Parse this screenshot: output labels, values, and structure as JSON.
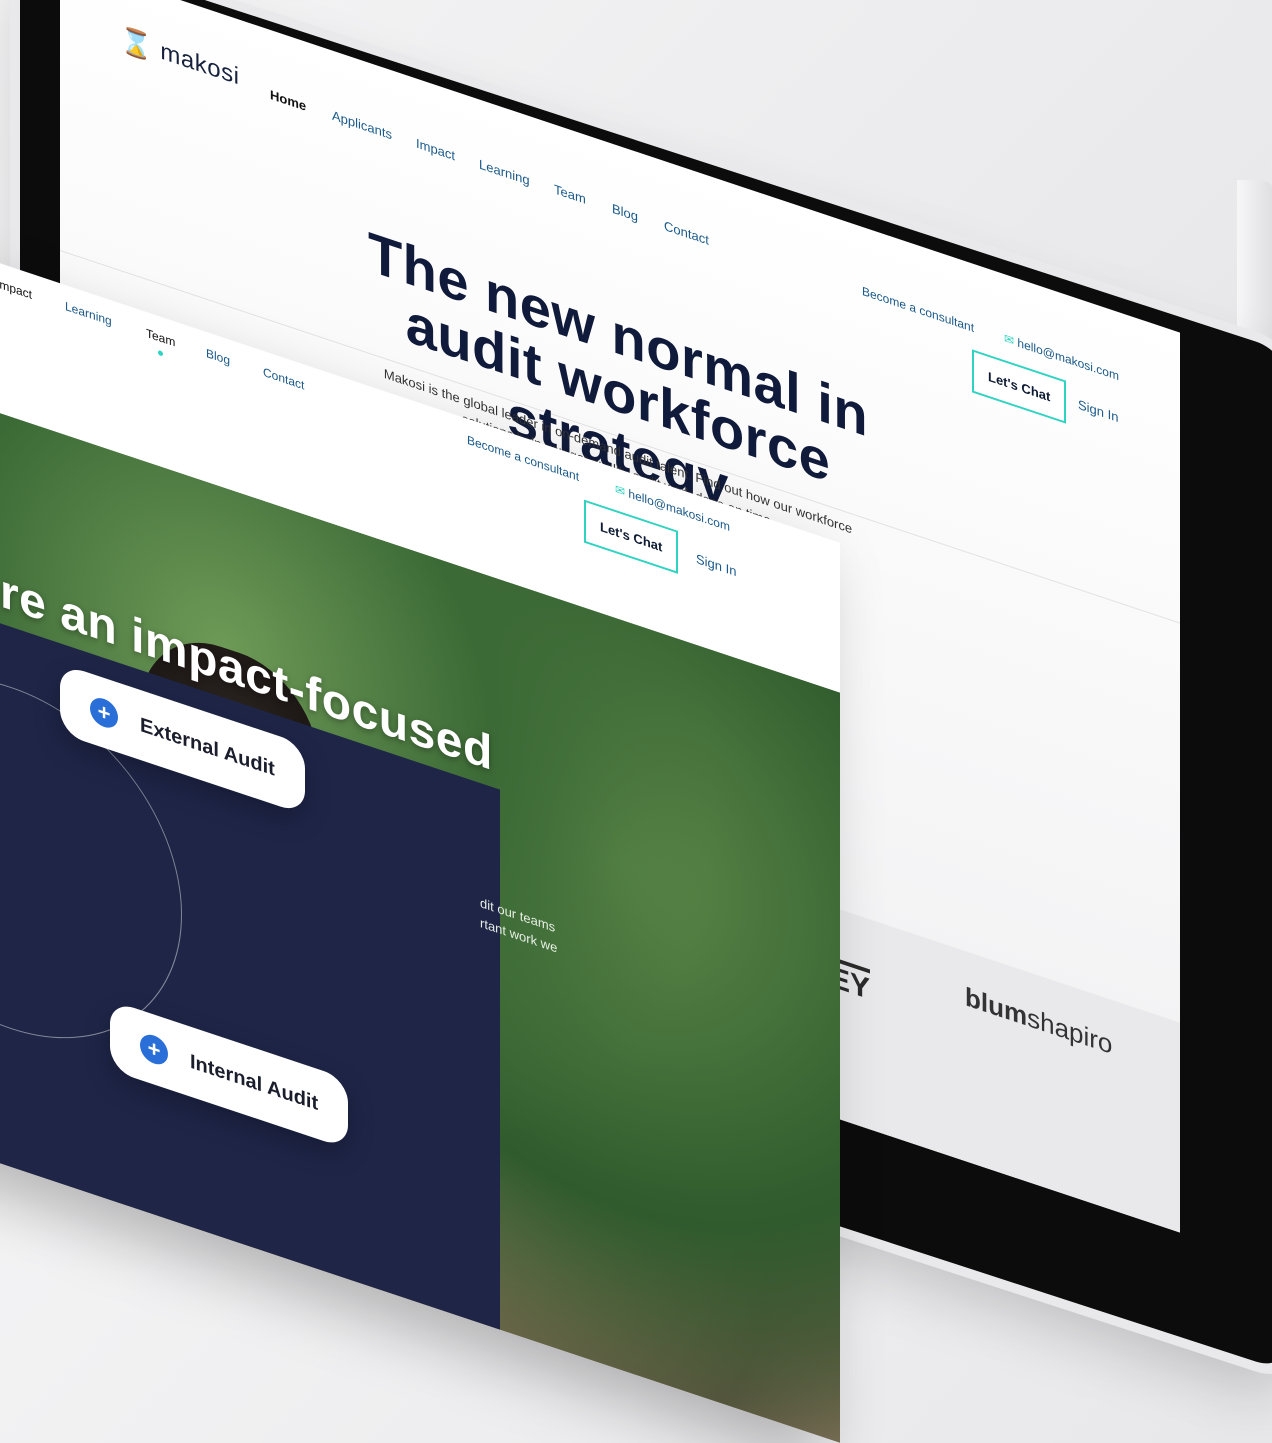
{
  "back_site": {
    "logo": {
      "mark": "⌛",
      "text": "makosi"
    },
    "nav": [
      {
        "label": "Home",
        "active": true
      },
      {
        "label": "Applicants",
        "active": false
      },
      {
        "label": "Impact",
        "active": false
      },
      {
        "label": "Learning",
        "active": false
      },
      {
        "label": "Team",
        "active": false
      },
      {
        "label": "Blog",
        "active": false
      },
      {
        "label": "Contact",
        "active": false
      }
    ],
    "become_consultant": "Become a consultant",
    "email": "hello@makosi.com",
    "lets_chat": "Let's Chat",
    "sign_in": "Sign In",
    "hero_title": "The new normal in audit workforce strategy",
    "hero_sub": "Makosi is the global leader in on-demand audit talent. Find out how our workforce solutions help you get quality audit work done on time.",
    "client_logos": {
      "ey": "EY",
      "blum_bold": "blum",
      "blum_light": "shapiro"
    }
  },
  "front_site": {
    "nav": [
      {
        "label": "Impact"
      },
      {
        "label": "Learning"
      },
      {
        "label": "Team"
      },
      {
        "label": "Blog"
      },
      {
        "label": "Contact"
      }
    ],
    "become_consultant": "Become a consultant",
    "email": "hello@makosi.com",
    "lets_chat": "Let's Chat",
    "sign_in": "Sign In",
    "headline": "re an impact-focused",
    "body_line1": "dit our teams",
    "body_line2": "rtant work we",
    "pill_external": "External Audit",
    "pill_internal": "Internal Audit",
    "plus": "+"
  },
  "colors": {
    "navy": "#1e2547",
    "accent_teal": "#2fd3c2",
    "link_blue": "#1b5a8a",
    "plus_blue": "#2a6fd8",
    "headline_dark": "#101a3a"
  },
  "icons": [
    "hourglass-logo-icon",
    "mail-icon",
    "plus-icon"
  ]
}
